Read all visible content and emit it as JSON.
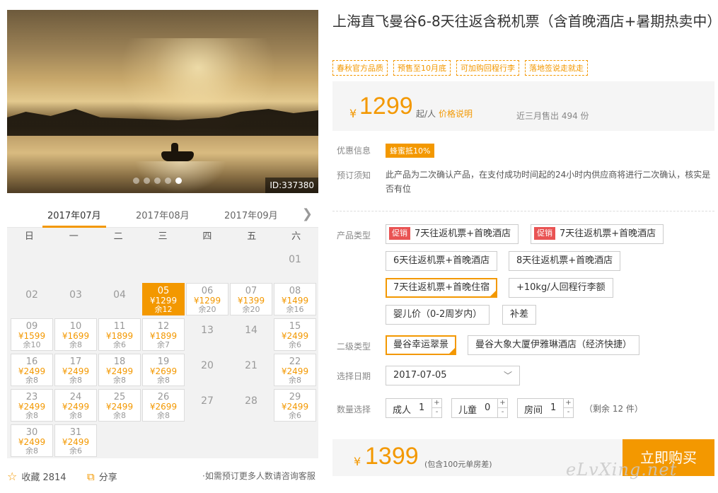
{
  "gallery": {
    "image_id": "ID:337380",
    "dots": 5,
    "active_dot": 5
  },
  "calendar": {
    "months": [
      "2017年07月",
      "2017年08月",
      "2017年09月"
    ],
    "weekdays": [
      "日",
      "一",
      "二",
      "三",
      "四",
      "五",
      "六"
    ],
    "days": [
      {
        "d": "",
        "t": "empty"
      },
      {
        "d": "",
        "t": "empty"
      },
      {
        "d": "",
        "t": "empty"
      },
      {
        "d": "",
        "t": "empty"
      },
      {
        "d": "",
        "t": "empty"
      },
      {
        "d": "",
        "t": "empty"
      },
      {
        "d": "01",
        "t": "plain"
      },
      {
        "d": "02",
        "t": "plain"
      },
      {
        "d": "03",
        "t": "plain"
      },
      {
        "d": "04",
        "t": "plain"
      },
      {
        "d": "05",
        "p": "¥1299",
        "r": "余12",
        "t": "sel"
      },
      {
        "d": "06",
        "p": "¥1299",
        "r": "余20",
        "t": "avail"
      },
      {
        "d": "07",
        "p": "¥1399",
        "r": "余20",
        "t": "avail"
      },
      {
        "d": "08",
        "p": "¥1499",
        "r": "余16",
        "t": "avail"
      },
      {
        "d": "09",
        "p": "¥1599",
        "r": "余10",
        "t": "avail"
      },
      {
        "d": "10",
        "p": "¥1699",
        "r": "余8",
        "t": "avail"
      },
      {
        "d": "11",
        "p": "¥1899",
        "r": "余6",
        "t": "avail"
      },
      {
        "d": "12",
        "p": "¥1899",
        "r": "余7",
        "t": "avail"
      },
      {
        "d": "13",
        "t": "plain"
      },
      {
        "d": "14",
        "t": "plain"
      },
      {
        "d": "15",
        "p": "¥2499",
        "r": "余6",
        "t": "avail"
      },
      {
        "d": "16",
        "p": "¥2499",
        "r": "余8",
        "t": "avail"
      },
      {
        "d": "17",
        "p": "¥2499",
        "r": "余8",
        "t": "avail"
      },
      {
        "d": "18",
        "p": "¥2499",
        "r": "余8",
        "t": "avail"
      },
      {
        "d": "19",
        "p": "¥2699",
        "r": "余8",
        "t": "avail"
      },
      {
        "d": "20",
        "t": "plain"
      },
      {
        "d": "21",
        "t": "plain"
      },
      {
        "d": "22",
        "p": "¥2499",
        "r": "余8",
        "t": "avail"
      },
      {
        "d": "23",
        "p": "¥2499",
        "r": "余8",
        "t": "avail"
      },
      {
        "d": "24",
        "p": "¥2499",
        "r": "余8",
        "t": "avail"
      },
      {
        "d": "25",
        "p": "¥2499",
        "r": "余8",
        "t": "avail"
      },
      {
        "d": "26",
        "p": "¥2699",
        "r": "余8",
        "t": "avail"
      },
      {
        "d": "27",
        "t": "plain"
      },
      {
        "d": "28",
        "t": "plain"
      },
      {
        "d": "29",
        "p": "¥2499",
        "r": "余6",
        "t": "avail"
      },
      {
        "d": "30",
        "p": "¥2499",
        "r": "余8",
        "t": "avail"
      },
      {
        "d": "31",
        "p": "¥2499",
        "r": "余6",
        "t": "avail"
      }
    ]
  },
  "footer_left": {
    "favorite": "收藏 2814",
    "share": "分享",
    "note": "·如需预订更多人数请咨询客服"
  },
  "product": {
    "title": "上海直飞曼谷6-8天往返含税机票（含首晚酒店+暑期热卖中）",
    "tags": [
      "春秋官方品质",
      "预售至10月底",
      "可加购回程行李",
      "落地签说走就走"
    ],
    "currency": "¥",
    "price": "1299",
    "price_unit": "起/人",
    "price_explain": "价格说明",
    "sold": "近三月售出 494 份"
  },
  "info": {
    "promo_label": "优惠信息",
    "promo_badge": "蜂蜜抵10%",
    "notice_label": "预订须知",
    "notice_text": "此产品为二次确认产品，在支付成功时间起的24小时内供应商将进行二次确认，核实是否有位"
  },
  "options": {
    "type_label": "产品类型",
    "promo_tag": "促销",
    "types": [
      "7天往返机票+首晚酒店",
      "7天往返机票+首晚酒店",
      "6天往返机票+首晚酒店",
      "8天往返机票+首晚酒店",
      "7天往返机票+首晚住宿",
      "+10kg/人回程行李额",
      "婴儿价（0-2周岁内）",
      "补差"
    ],
    "sub_label": "二级类型",
    "subs": [
      "曼谷幸运翠景",
      "曼谷大象大厦伊雅琳酒店（经济快捷）"
    ],
    "date_label": "选择日期",
    "date_value": "2017-07-05",
    "qty_label": "数量选择",
    "adult_label": "成人",
    "adult_value": "1",
    "child_label": "儿童",
    "child_value": "0",
    "room_label": "房间",
    "room_value": "1",
    "remain": "（剩余 12 件）"
  },
  "total": {
    "currency": "¥",
    "price": "1399",
    "note": "(包含100元单房差)",
    "buy": "立即购买"
  },
  "watermark": "eLvXing.net",
  "colors": {
    "accent": "#f39800",
    "promo_red": "#e95353"
  }
}
